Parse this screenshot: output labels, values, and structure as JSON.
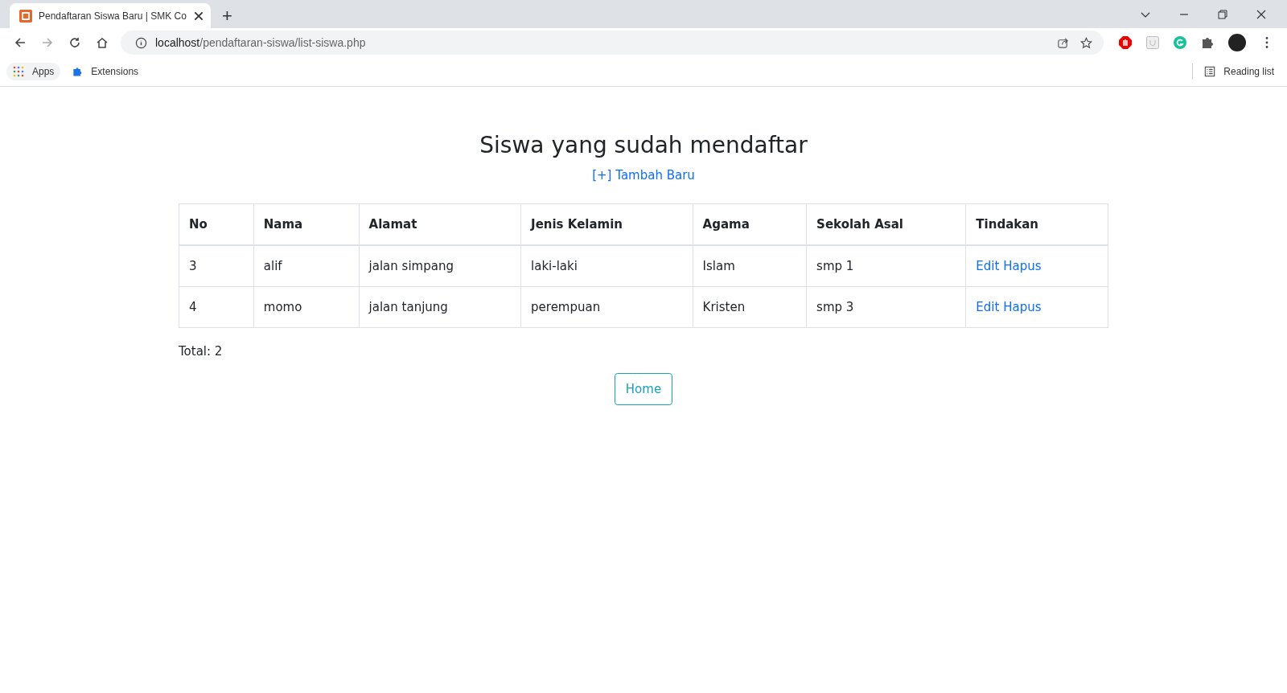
{
  "browser": {
    "tab_title": "Pendaftaran Siswa Baru | SMK Co",
    "new_tab": "+",
    "url_host": "localhost",
    "url_path": "/pendaftaran-siswa/list-siswa.php",
    "bookmarks": [
      "Apps",
      "Extensions"
    ],
    "reading_list": "Reading list"
  },
  "page": {
    "title": "Siswa yang sudah mendaftar",
    "add_link": "[+] Tambah Baru",
    "table": {
      "columns": [
        "No",
        "Nama",
        "Alamat",
        "Jenis Kelamin",
        "Agama",
        "Sekolah Asal",
        "Tindakan"
      ],
      "rows": [
        {
          "cells": [
            "3",
            "alif",
            "jalan simpang",
            "laki-laki",
            "Islam",
            "smp 1"
          ],
          "actions": [
            "Edit",
            "Hapus"
          ]
        },
        {
          "cells": [
            "4",
            "momo",
            "jalan tanjung",
            "perempuan",
            "Kristen",
            "smp 3"
          ],
          "actions": [
            "Edit",
            "Hapus"
          ]
        }
      ]
    },
    "total": "Total: 2",
    "home_button": "Home"
  }
}
